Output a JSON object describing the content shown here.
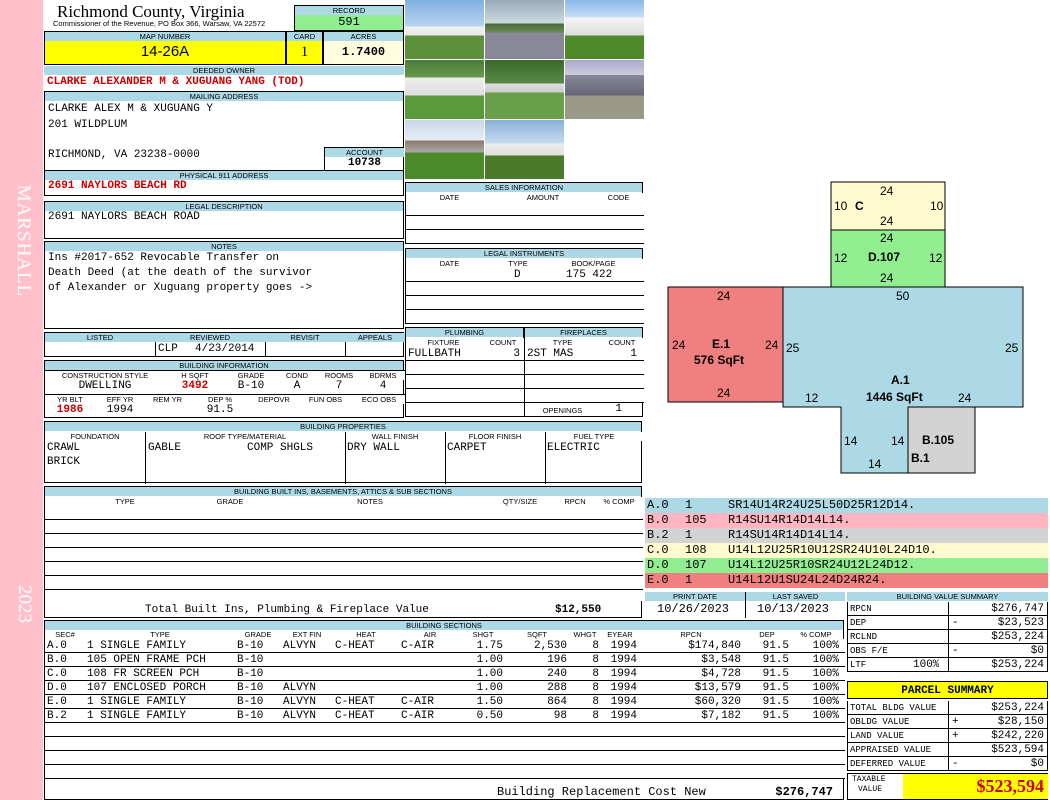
{
  "sidebar": {
    "name": "MARSHALL",
    "year": "2023"
  },
  "header": {
    "county": "Richmond County, Virginia",
    "commissioner": "Commissioner of the Revenue, PO Box 366, Warsaw, VA 22572",
    "record_label": "RECORD",
    "record": "591",
    "map_label": "MAP NUMBER",
    "map_number": "14-26A",
    "card_label": "CARD",
    "card": "1",
    "acres_label": "ACRES",
    "acres": "1.7400"
  },
  "owner": {
    "deeded_label": "DEEDED OWNER",
    "deeded": "CLARKE ALEXANDER M & XUGUANG YANG (TOD)",
    "mailing_label": "MAILING ADDRESS",
    "mail1": "CLARKE ALEX M & XUGUANG Y",
    "mail2": "201 WILDPLUM",
    "mail3": "RICHMOND, VA 23238-0000",
    "account_label": "ACCOUNT",
    "account": "10738",
    "phys_label": "PHYSICAL 911 ADDRESS",
    "phys": "2691 NAYLORS BEACH RD",
    "legal_label": "LEGAL DESCRIPTION",
    "legal": "2691 NAYLORS BEACH ROAD",
    "notes_label": "NOTES",
    "notes1": "Ins #2017-652 Revocable Transfer on",
    "notes2": "Death Deed (at the death of the survivor",
    "notes3": "of Alexander or Xuguang property goes ->"
  },
  "review": {
    "h_listed": "LISTED",
    "h_reviewed": "REVIEWED",
    "h_revisit": "REVISIT",
    "h_appeals": "APPEALS",
    "reviewed_by": "CLP",
    "reviewed_date": "4/23/2014"
  },
  "building_info": {
    "title": "BUILDING INFORMATION",
    "h_cs": "CONSTRUCTION STYLE",
    "h_hsqft": "H SQFT",
    "h_grade": "GRADE",
    "h_cond": "COND",
    "h_rooms": "ROOMS",
    "h_bdrms": "BDRMS",
    "cs": "DWELLING",
    "hsqft": "3492",
    "grade": "B-10",
    "cond": "A",
    "rooms": "7",
    "bdrms": "4",
    "h_yrblt": "YR BLT",
    "h_effyr": "EFF YR",
    "h_remyr": "REM YR",
    "h_dep": "DEP %",
    "h_depovr": "DEPOVR",
    "h_funobs": "FUN OBS",
    "h_ecoobs": "ECO OBS",
    "yrblt": "1986",
    "effyr": "1994",
    "dep": "91.5"
  },
  "props": {
    "title": "BUILDING PROPERTIES",
    "h_found": "FOUNDATION",
    "h_roof": "ROOF TYPE/MATERIAL",
    "h_wall": "WALL FINISH",
    "h_floor": "FLOOR FINISH",
    "h_fuel": "FUEL TYPE",
    "found1": "CRAWL",
    "found2": "BRICK",
    "roof1": "GABLE",
    "roof2": "COMP SHGLS",
    "wall": "DRY WALL",
    "floor": "CARPET",
    "fuel": "ELECTRIC"
  },
  "builtins": {
    "title": "BUILDING BUILT INS, BASEMENTS, ATTICS & SUB SECTIONS",
    "h_type": "TYPE",
    "h_grade": "GRADE",
    "h_notes": "NOTES",
    "h_qty": "QTY/SIZE",
    "h_rpcn": "RPCN",
    "h_comp": "% COMP",
    "total_label": "Total Built Ins, Plumbing & Fireplace Value",
    "total": "$12,550"
  },
  "sales": {
    "title": "SALES INFORMATION",
    "h_date": "DATE",
    "h_amount": "AMOUNT",
    "h_code": "CODE"
  },
  "legal_inst": {
    "title": "LEGAL INSTRUMENTS",
    "h_date": "DATE",
    "h_type": "TYPE",
    "h_bp": "BOOK/PAGE",
    "type": "D",
    "bp": "175 422"
  },
  "plumbing": {
    "title": "PLUMBING",
    "h_fixture": "FIXTURE",
    "h_count": "COUNT",
    "fixture": "FULLBATH",
    "count": "3"
  },
  "fireplaces": {
    "title": "FIREPLACES",
    "h_type": "TYPE",
    "h_count": "COUNT",
    "type": "2ST MAS",
    "count": "1",
    "openings_label": "OPENINGS",
    "openings": "1"
  },
  "sketch": {
    "C": "C",
    "D": "D.107",
    "E": "E.1",
    "E_sq": "576 SqFt",
    "A": "A.1",
    "A_sq": "1446 SqFt",
    "B": "B.105",
    "B1": "B.1",
    "n10": "10",
    "n12": "12",
    "n14": "14",
    "n24": "24",
    "n25": "25",
    "n50": "50"
  },
  "legend": [
    {
      "code": "A.0",
      "num": "1",
      "desc": "SR14U14R24U25L50D25R12D14.",
      "color": "#add8e6"
    },
    {
      "code": "B.0",
      "num": "105",
      "desc": "R14SU14R14D14L14.",
      "color": "#ffb6c1"
    },
    {
      "code": "B.2",
      "num": "1",
      "desc": "R14SU14R14D14L14.",
      "color": "#d3d3d3"
    },
    {
      "code": "C.0",
      "num": "108",
      "desc": "U14L12U25R10U12SR24U10L24D10.",
      "color": "#fffacd"
    },
    {
      "code": "D.0",
      "num": "107",
      "desc": "U14L12U25R10SR24U12L24D12.",
      "color": "#90ee90"
    },
    {
      "code": "E.0",
      "num": "1",
      "desc": "U14L12U1SU24L24D24R24.",
      "color": "#f08080"
    }
  ],
  "dates": {
    "h_print": "PRINT DATE",
    "h_saved": "LAST SAVED",
    "print": "10/26/2023",
    "saved": "10/13/2023"
  },
  "sections": {
    "title": "BUILDING SECTIONS",
    "h_sec": "SEC#",
    "h_type": "TYPE",
    "h_grade": "GRADE",
    "h_ext": "EXT FIN",
    "h_heat": "HEAT",
    "h_air": "AIR",
    "h_shgt": "SHGT",
    "h_sqft": "SQFT",
    "h_whgt": "WHGT",
    "h_eyear": "EYEAR",
    "h_rpcn": "RPCN",
    "h_dep": "DEP",
    "h_comp": "% COMP",
    "rows": [
      {
        "sec": "A.0",
        "type": "1 SINGLE FAMILY",
        "grade": "B-10",
        "ext": "ALVYN",
        "heat": "C-HEAT",
        "air": "C-AIR",
        "shgt": "1.75",
        "sqft": "2,530",
        "whgt": "8",
        "eyear": "1994",
        "rpcn": "$174,840",
        "dep": "91.5",
        "comp": "100%"
      },
      {
        "sec": "B.0",
        "type": "105 OPEN FRAME PCH",
        "grade": "B-10",
        "ext": "",
        "heat": "",
        "air": "",
        "shgt": "1.00",
        "sqft": "196",
        "whgt": "8",
        "eyear": "1994",
        "rpcn": "$3,548",
        "dep": "91.5",
        "comp": "100%"
      },
      {
        "sec": "C.0",
        "type": "108 FR SCREEN PCH",
        "grade": "B-10",
        "ext": "",
        "heat": "",
        "air": "",
        "shgt": "1.00",
        "sqft": "240",
        "whgt": "8",
        "eyear": "1994",
        "rpcn": "$4,728",
        "dep": "91.5",
        "comp": "100%"
      },
      {
        "sec": "D.0",
        "type": "107 ENCLOSED PORCH",
        "grade": "B-10",
        "ext": "ALVYN",
        "heat": "",
        "air": "",
        "shgt": "1.00",
        "sqft": "288",
        "whgt": "8",
        "eyear": "1994",
        "rpcn": "$13,579",
        "dep": "91.5",
        "comp": "100%"
      },
      {
        "sec": "E.0",
        "type": "1 SINGLE FAMILY",
        "grade": "B-10",
        "ext": "ALVYN",
        "heat": "C-HEAT",
        "air": "C-AIR",
        "shgt": "1.50",
        "sqft": "864",
        "whgt": "8",
        "eyear": "1994",
        "rpcn": "$60,320",
        "dep": "91.5",
        "comp": "100%"
      },
      {
        "sec": "B.2",
        "type": "1 SINGLE FAMILY",
        "grade": "B-10",
        "ext": "ALVYN",
        "heat": "C-HEAT",
        "air": "C-AIR",
        "shgt": "0.50",
        "sqft": "98",
        "whgt": "8",
        "eyear": "1994",
        "rpcn": "$7,182",
        "dep": "91.5",
        "comp": "100%"
      }
    ],
    "total_label": "Building Replacement Cost New",
    "total": "$276,747"
  },
  "bvs": {
    "title": "BUILDING VALUE SUMMARY",
    "rows": [
      {
        "label": "RPCN",
        "sign": "",
        "val": "$276,747"
      },
      {
        "label": "DEP",
        "sign": "-",
        "val": "$23,523"
      },
      {
        "label": "RCLND",
        "sign": "",
        "val": "$253,224"
      },
      {
        "label": "OBS F/E",
        "sign": "-",
        "val": "$0"
      },
      {
        "label": "LTF",
        "pct": "100%",
        "sign": "",
        "val": "$253,224"
      }
    ]
  },
  "parcel": {
    "title": "PARCEL SUMMARY",
    "rows": [
      {
        "label": "TOTAL BLDG VALUE",
        "sign": "",
        "val": "$253,224"
      },
      {
        "label": "OBLDG VALUE",
        "sign": "+",
        "val": "$28,150"
      },
      {
        "label": "LAND VALUE",
        "sign": "+",
        "val": "$242,220"
      },
      {
        "label": "APPRAISED VALUE",
        "sign": "",
        "val": "$523,594"
      },
      {
        "label": "DEFERRED VALUE",
        "sign": "-",
        "val": "$0"
      }
    ],
    "taxable_label1": "TAXABLE",
    "taxable_label2": "VALUE",
    "taxable": "$523,594"
  }
}
